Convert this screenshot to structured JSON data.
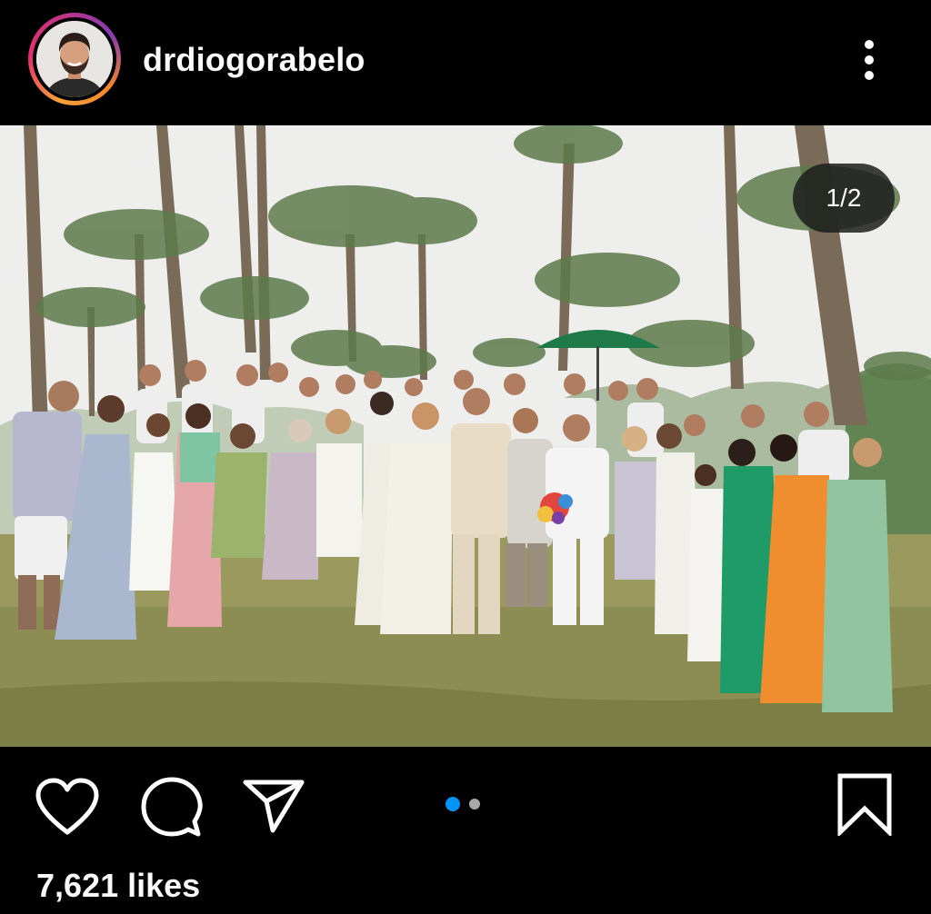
{
  "header": {
    "username": "drdiogorabelo",
    "avatar_icon": "profile-photo",
    "more_icon": "more-vertical-icon"
  },
  "photo": {
    "description_icon": "group-photo",
    "page_indicator": "1/2"
  },
  "actions": {
    "like_icon": "heart-icon",
    "comment_icon": "comment-icon",
    "share_icon": "send-icon",
    "save_icon": "bookmark-icon"
  },
  "carousel": {
    "count": 2,
    "active_index": 0,
    "active_color": "#0095f6",
    "inactive_color": "#a8a8a8"
  },
  "likes": {
    "text": "7,621 likes"
  }
}
